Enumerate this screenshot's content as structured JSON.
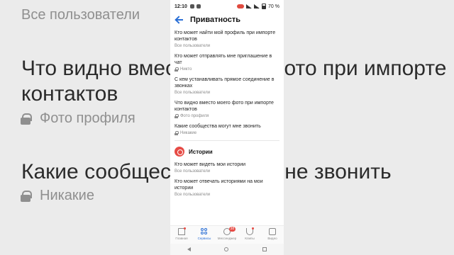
{
  "background": {
    "line1": "Все пользователи",
    "line2": "Что видно вместо моего фото при импорте",
    "line3": "контактов",
    "line4": "Фото профиля",
    "line5": "Какие сообщества могут мне звонить",
    "line6": "Никакие"
  },
  "status": {
    "time": "12:10",
    "battery": "70 %"
  },
  "header": {
    "title": "Приватность"
  },
  "items": [
    {
      "q": "Кто может найти мой профиль при импорте контактов",
      "a": "Все пользователи",
      "locked": false
    },
    {
      "q": "Кто может отправлять мне приглашение в чат",
      "a": "Никто",
      "locked": true
    },
    {
      "q": "С кем устанавливать прямое соединение в звонках",
      "a": "Все пользователи",
      "locked": false
    },
    {
      "q": "Что видно вместо моего фото при импорте контактов",
      "a": "Фото профиля",
      "locked": true
    },
    {
      "q": "Какие сообщества могут мне звонить",
      "a": "Никакие",
      "locked": true
    }
  ],
  "stories_section": {
    "title": "Истории"
  },
  "stories_items": [
    {
      "q": "Кто может видеть мои истории",
      "a": "Все пользователи"
    },
    {
      "q": "Кто может отвечать историями на мои истории",
      "a": "Все пользователи"
    }
  ],
  "tabs": [
    {
      "label": "Главная",
      "icon": "home-icon"
    },
    {
      "label": "Сервисы",
      "icon": "services-icon",
      "active": true
    },
    {
      "label": "Мессенджер",
      "icon": "messenger-icon",
      "badge": "38"
    },
    {
      "label": "Клипы",
      "icon": "clips-icon"
    },
    {
      "label": "Видео",
      "icon": "video-icon"
    }
  ],
  "colors": {
    "accent": "#2a6fd6",
    "red": "#e64b45"
  }
}
